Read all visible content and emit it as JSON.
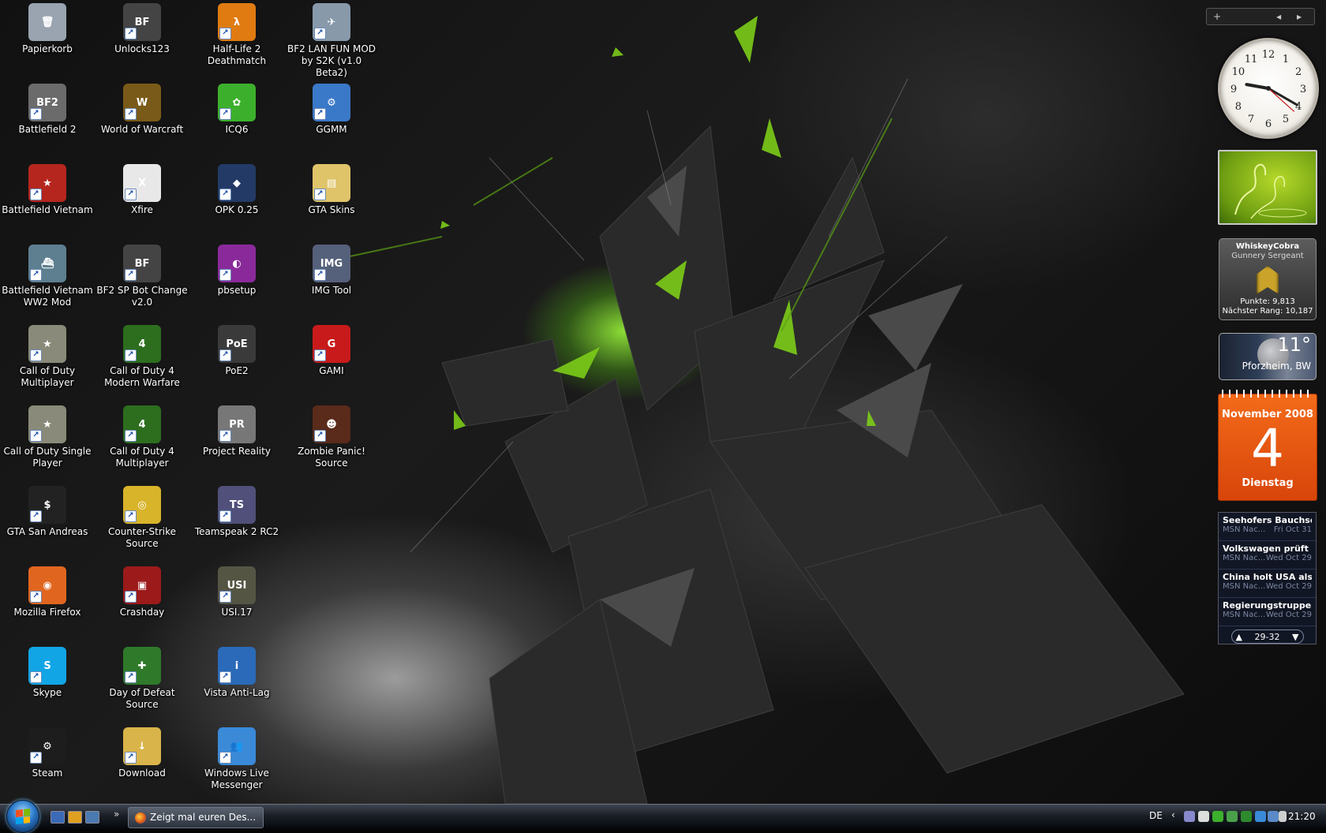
{
  "desktop": {
    "icons": [
      {
        "label": "Papierkorb",
        "glyph": "🗑",
        "color": "#9aa4b0"
      },
      {
        "label": "Battlefield 2",
        "glyph": "BF2",
        "color": "#6b6b6b"
      },
      {
        "label": "Battlefield Vietnam",
        "glyph": "★",
        "color": "#b5261e"
      },
      {
        "label": "Battlefield Vietnam WW2 Mod",
        "glyph": "⛴",
        "color": "#5d7f90"
      },
      {
        "label": "Call of Duty Multiplayer",
        "glyph": "★",
        "color": "#8a8a7a"
      },
      {
        "label": "Call of Duty Single Player",
        "glyph": "★",
        "color": "#8a8a7a"
      },
      {
        "label": "GTA San Andreas",
        "glyph": "$",
        "color": "#222222"
      },
      {
        "label": "Mozilla Firefox",
        "glyph": "◉",
        "color": "#e0661f"
      },
      {
        "label": "Skype",
        "glyph": "S",
        "color": "#12a5e6"
      },
      {
        "label": "Steam",
        "glyph": "⚙",
        "color": "#1d1d1d"
      },
      {
        "label": "Unlocks123",
        "glyph": "BF",
        "color": "#444444"
      },
      {
        "label": "World of Warcraft",
        "glyph": "W",
        "color": "#7a5a18"
      },
      {
        "label": "Xfire",
        "glyph": "X",
        "color": "#e8e8e8"
      },
      {
        "label": "BF2 SP Bot Change v2.0",
        "glyph": "BF",
        "color": "#444444"
      },
      {
        "label": "Call of Duty 4 Modern Warfare",
        "glyph": "4",
        "color": "#2c6e1e"
      },
      {
        "label": "Call of Duty 4 Multiplayer",
        "glyph": "4",
        "color": "#2c6e1e"
      },
      {
        "label": "Counter-Strike Source",
        "glyph": "◎",
        "color": "#d8b42a"
      },
      {
        "label": "Crashday",
        "glyph": "▣",
        "color": "#9c1a1a"
      },
      {
        "label": "Day of Defeat Source",
        "glyph": "✚",
        "color": "#2f7a2a"
      },
      {
        "label": "Download",
        "glyph": "↓",
        "color": "#d9b44a"
      },
      {
        "label": "Half-Life 2 Deathmatch",
        "glyph": "λ",
        "color": "#e07b12"
      },
      {
        "label": "ICQ6",
        "glyph": "✿",
        "color": "#3cb02c"
      },
      {
        "label": "OPK 0.25",
        "glyph": "◆",
        "color": "#233a66"
      },
      {
        "label": "pbsetup",
        "glyph": "◐",
        "color": "#8a2a9a"
      },
      {
        "label": "PoE2",
        "glyph": "PoE",
        "color": "#3a3a3a"
      },
      {
        "label": "Project Reality",
        "glyph": "PR",
        "color": "#777777"
      },
      {
        "label": "Teamspeak 2 RC2",
        "glyph": "TS",
        "color": "#50507a"
      },
      {
        "label": "USI.17",
        "glyph": "USI",
        "color": "#555544"
      },
      {
        "label": "Vista Anti-Lag",
        "glyph": "i",
        "color": "#2a6ab8"
      },
      {
        "label": "Windows Live Messenger",
        "glyph": "👥",
        "color": "#3a8ad8"
      },
      {
        "label": "BF2 LAN FUN MOD by S2K (v1.0 Beta2)",
        "glyph": "✈",
        "color": "#8899aa"
      },
      {
        "label": "GGMM",
        "glyph": "⚙",
        "color": "#3a78c8"
      },
      {
        "label": "GTA Skins",
        "glyph": "▤",
        "color": "#e0c46a"
      },
      {
        "label": "IMG Tool",
        "glyph": "IMG",
        "color": "#55607a"
      },
      {
        "label": "GAMI",
        "glyph": "G",
        "color": "#c81a1a"
      },
      {
        "label": "Zombie Panic! Source",
        "glyph": "☻",
        "color": "#5a2a1a"
      }
    ]
  },
  "sidebar": {
    "add_icon": "+",
    "prev_icon": "◂",
    "next_icon": "▸",
    "clock": {
      "hour": 9,
      "minute": 20,
      "second": 22
    },
    "rank": {
      "name": "WhiskeyCobra",
      "title": "Gunnery Sergeant",
      "points": "Punkte: 9,813",
      "next_rank": "Nächster Rang: 10,187"
    },
    "weather": {
      "temp": "11°",
      "city": "Pforzheim, BW"
    },
    "calendar": {
      "month": "November 2008",
      "day": "4",
      "weekday": "Dienstag"
    },
    "news": {
      "items": [
        {
          "headline": "Seehofers Bauchsch...",
          "source": "MSN Nac...",
          "date": "Fri Oct 31"
        },
        {
          "headline": "Volkswagen prüft Pr...",
          "source": "MSN Nac...",
          "date": "Wed Oct 29"
        },
        {
          "headline": "China holt USA als gr...",
          "source": "MSN Nac...",
          "date": "Wed Oct 29"
        },
        {
          "headline": "Regierungstruppen fl...",
          "source": "MSN Nac...",
          "date": "Wed Oct 29"
        }
      ],
      "pager": "29-32",
      "up_icon": "▲",
      "down_icon": "▼"
    }
  },
  "taskbar": {
    "more_icon": "»",
    "task": "Zeigt mal euren Des...",
    "lang": "DE",
    "tray_arrow": "‹",
    "time": "21:20"
  },
  "colors": {
    "accent_green": "#8fd11e",
    "calendar_orange": "#e8560f",
    "taskbar": "#1a1f27"
  }
}
